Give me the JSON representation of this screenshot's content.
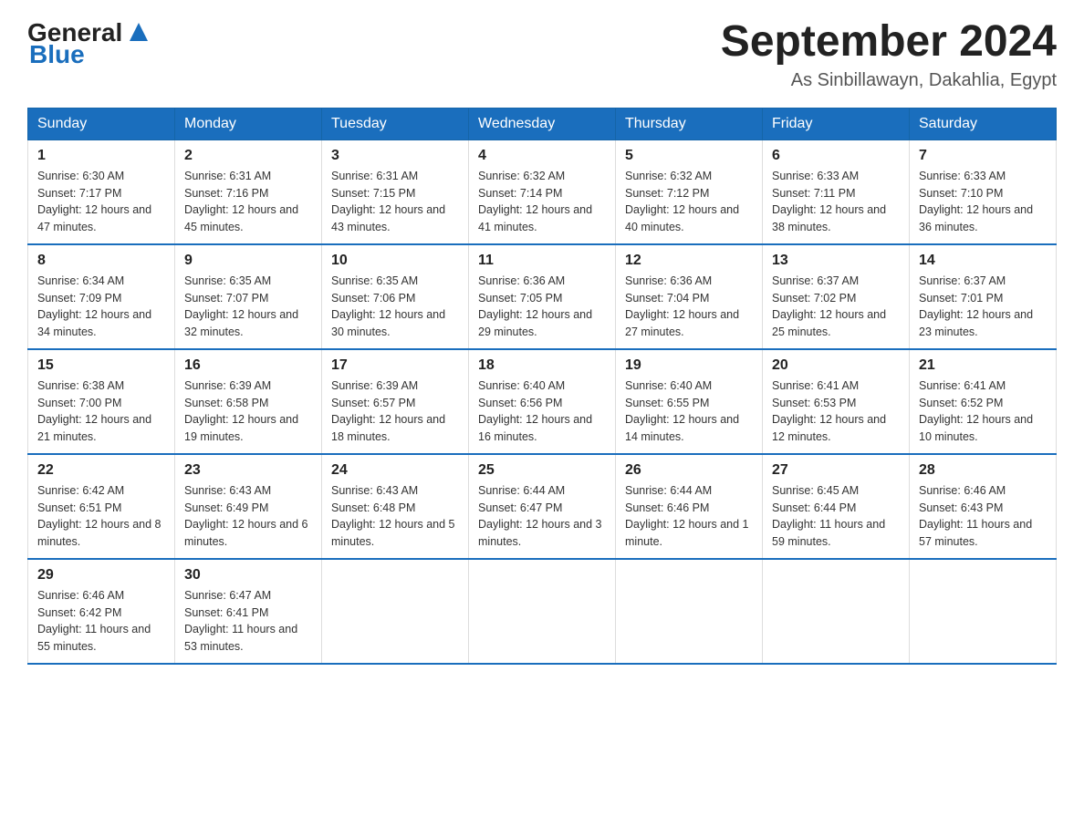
{
  "logo": {
    "text_general": "General",
    "text_blue": "Blue",
    "aria": "GeneralBlue logo"
  },
  "title": "September 2024",
  "subtitle": "As Sinbillawayn, Dakahlia, Egypt",
  "days_of_week": [
    "Sunday",
    "Monday",
    "Tuesday",
    "Wednesday",
    "Thursday",
    "Friday",
    "Saturday"
  ],
  "weeks": [
    [
      {
        "day": "1",
        "sunrise": "Sunrise: 6:30 AM",
        "sunset": "Sunset: 7:17 PM",
        "daylight": "Daylight: 12 hours and 47 minutes."
      },
      {
        "day": "2",
        "sunrise": "Sunrise: 6:31 AM",
        "sunset": "Sunset: 7:16 PM",
        "daylight": "Daylight: 12 hours and 45 minutes."
      },
      {
        "day": "3",
        "sunrise": "Sunrise: 6:31 AM",
        "sunset": "Sunset: 7:15 PM",
        "daylight": "Daylight: 12 hours and 43 minutes."
      },
      {
        "day": "4",
        "sunrise": "Sunrise: 6:32 AM",
        "sunset": "Sunset: 7:14 PM",
        "daylight": "Daylight: 12 hours and 41 minutes."
      },
      {
        "day": "5",
        "sunrise": "Sunrise: 6:32 AM",
        "sunset": "Sunset: 7:12 PM",
        "daylight": "Daylight: 12 hours and 40 minutes."
      },
      {
        "day": "6",
        "sunrise": "Sunrise: 6:33 AM",
        "sunset": "Sunset: 7:11 PM",
        "daylight": "Daylight: 12 hours and 38 minutes."
      },
      {
        "day": "7",
        "sunrise": "Sunrise: 6:33 AM",
        "sunset": "Sunset: 7:10 PM",
        "daylight": "Daylight: 12 hours and 36 minutes."
      }
    ],
    [
      {
        "day": "8",
        "sunrise": "Sunrise: 6:34 AM",
        "sunset": "Sunset: 7:09 PM",
        "daylight": "Daylight: 12 hours and 34 minutes."
      },
      {
        "day": "9",
        "sunrise": "Sunrise: 6:35 AM",
        "sunset": "Sunset: 7:07 PM",
        "daylight": "Daylight: 12 hours and 32 minutes."
      },
      {
        "day": "10",
        "sunrise": "Sunrise: 6:35 AM",
        "sunset": "Sunset: 7:06 PM",
        "daylight": "Daylight: 12 hours and 30 minutes."
      },
      {
        "day": "11",
        "sunrise": "Sunrise: 6:36 AM",
        "sunset": "Sunset: 7:05 PM",
        "daylight": "Daylight: 12 hours and 29 minutes."
      },
      {
        "day": "12",
        "sunrise": "Sunrise: 6:36 AM",
        "sunset": "Sunset: 7:04 PM",
        "daylight": "Daylight: 12 hours and 27 minutes."
      },
      {
        "day": "13",
        "sunrise": "Sunrise: 6:37 AM",
        "sunset": "Sunset: 7:02 PM",
        "daylight": "Daylight: 12 hours and 25 minutes."
      },
      {
        "day": "14",
        "sunrise": "Sunrise: 6:37 AM",
        "sunset": "Sunset: 7:01 PM",
        "daylight": "Daylight: 12 hours and 23 minutes."
      }
    ],
    [
      {
        "day": "15",
        "sunrise": "Sunrise: 6:38 AM",
        "sunset": "Sunset: 7:00 PM",
        "daylight": "Daylight: 12 hours and 21 minutes."
      },
      {
        "day": "16",
        "sunrise": "Sunrise: 6:39 AM",
        "sunset": "Sunset: 6:58 PM",
        "daylight": "Daylight: 12 hours and 19 minutes."
      },
      {
        "day": "17",
        "sunrise": "Sunrise: 6:39 AM",
        "sunset": "Sunset: 6:57 PM",
        "daylight": "Daylight: 12 hours and 18 minutes."
      },
      {
        "day": "18",
        "sunrise": "Sunrise: 6:40 AM",
        "sunset": "Sunset: 6:56 PM",
        "daylight": "Daylight: 12 hours and 16 minutes."
      },
      {
        "day": "19",
        "sunrise": "Sunrise: 6:40 AM",
        "sunset": "Sunset: 6:55 PM",
        "daylight": "Daylight: 12 hours and 14 minutes."
      },
      {
        "day": "20",
        "sunrise": "Sunrise: 6:41 AM",
        "sunset": "Sunset: 6:53 PM",
        "daylight": "Daylight: 12 hours and 12 minutes."
      },
      {
        "day": "21",
        "sunrise": "Sunrise: 6:41 AM",
        "sunset": "Sunset: 6:52 PM",
        "daylight": "Daylight: 12 hours and 10 minutes."
      }
    ],
    [
      {
        "day": "22",
        "sunrise": "Sunrise: 6:42 AM",
        "sunset": "Sunset: 6:51 PM",
        "daylight": "Daylight: 12 hours and 8 minutes."
      },
      {
        "day": "23",
        "sunrise": "Sunrise: 6:43 AM",
        "sunset": "Sunset: 6:49 PM",
        "daylight": "Daylight: 12 hours and 6 minutes."
      },
      {
        "day": "24",
        "sunrise": "Sunrise: 6:43 AM",
        "sunset": "Sunset: 6:48 PM",
        "daylight": "Daylight: 12 hours and 5 minutes."
      },
      {
        "day": "25",
        "sunrise": "Sunrise: 6:44 AM",
        "sunset": "Sunset: 6:47 PM",
        "daylight": "Daylight: 12 hours and 3 minutes."
      },
      {
        "day": "26",
        "sunrise": "Sunrise: 6:44 AM",
        "sunset": "Sunset: 6:46 PM",
        "daylight": "Daylight: 12 hours and 1 minute."
      },
      {
        "day": "27",
        "sunrise": "Sunrise: 6:45 AM",
        "sunset": "Sunset: 6:44 PM",
        "daylight": "Daylight: 11 hours and 59 minutes."
      },
      {
        "day": "28",
        "sunrise": "Sunrise: 6:46 AM",
        "sunset": "Sunset: 6:43 PM",
        "daylight": "Daylight: 11 hours and 57 minutes."
      }
    ],
    [
      {
        "day": "29",
        "sunrise": "Sunrise: 6:46 AM",
        "sunset": "Sunset: 6:42 PM",
        "daylight": "Daylight: 11 hours and 55 minutes."
      },
      {
        "day": "30",
        "sunrise": "Sunrise: 6:47 AM",
        "sunset": "Sunset: 6:41 PM",
        "daylight": "Daylight: 11 hours and 53 minutes."
      },
      null,
      null,
      null,
      null,
      null
    ]
  ]
}
